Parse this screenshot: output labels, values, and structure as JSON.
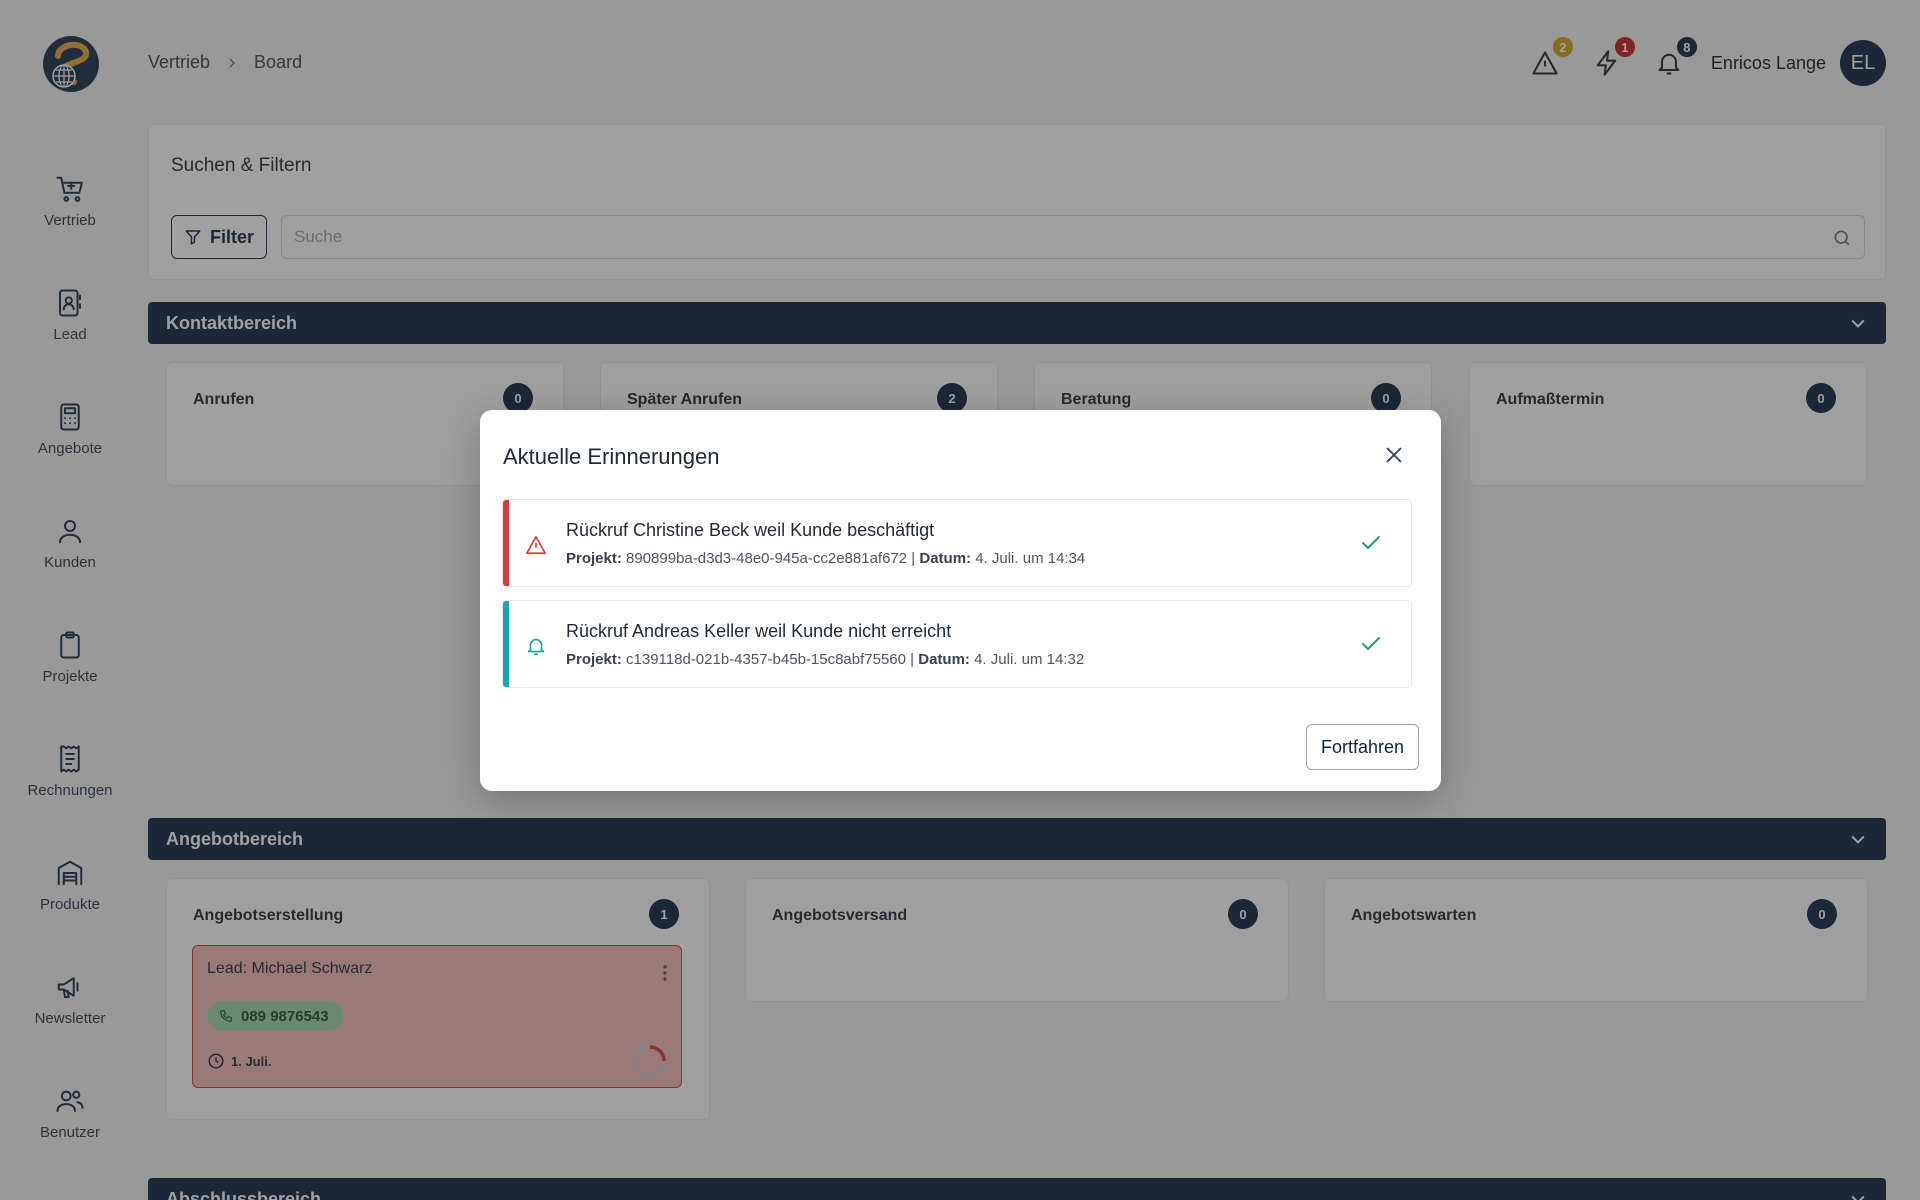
{
  "sidebar": {
    "items": [
      {
        "label": "Vertrieb",
        "icon": "cart-plus-icon"
      },
      {
        "label": "Lead",
        "icon": "contact-book-icon"
      },
      {
        "label": "Angebote",
        "icon": "calculator-icon"
      },
      {
        "label": "Kunden",
        "icon": "user-icon"
      },
      {
        "label": "Projekte",
        "icon": "clipboard-icon"
      },
      {
        "label": "Rechnungen",
        "icon": "receipt-icon"
      },
      {
        "label": "Produkte",
        "icon": "warehouse-icon"
      },
      {
        "label": "Newsletter",
        "icon": "megaphone-icon"
      },
      {
        "label": "Benutzer",
        "icon": "users-icon"
      }
    ]
  },
  "header": {
    "breadcrumb": [
      "Vertrieb",
      "Board"
    ],
    "badges": {
      "warnings": "2",
      "actions": "1",
      "notifications": "8"
    },
    "user_name": "Enricos Lange",
    "avatar_initials": "EL"
  },
  "search": {
    "title": "Suchen & Filtern",
    "filter_label": "Filter",
    "placeholder": "Suche"
  },
  "sections": {
    "contact": {
      "title": "Kontaktbereich",
      "columns": [
        {
          "title": "Anrufen",
          "count": "0"
        },
        {
          "title": "Später Anrufen",
          "count": "2"
        },
        {
          "title": "Beratung",
          "count": "0"
        },
        {
          "title": "Aufmaßtermin",
          "count": "0"
        }
      ]
    },
    "offer": {
      "title": "Angebotbereich",
      "columns": [
        {
          "title": "Angebotserstellung",
          "count": "1"
        },
        {
          "title": "Angebotsversand",
          "count": "0"
        },
        {
          "title": "Angebotswarten",
          "count": "0"
        }
      ]
    },
    "closing": {
      "title": "Abschlussbereich"
    }
  },
  "lead_card": {
    "title": "Lead: Michael Schwarz",
    "phone": "089 9876543",
    "date": "1. Juli."
  },
  "modal": {
    "title": "Aktuelle Erinnerungen",
    "reminders": [
      {
        "title": "Rückruf Christine Beck weil Kunde beschäftigt",
        "project_label": "Projekt:",
        "project_id": "890899ba-d3d3-48e0-945a-cc2e881af672",
        "separator": "|",
        "date_label": "Datum:",
        "date": "4. Juli. um 14:34",
        "type": "warning"
      },
      {
        "title": "Rückruf Andreas Keller weil Kunde nicht erreicht",
        "project_label": "Projekt:",
        "project_id": "c139118d-021b-4357-b45b-15c8abf75560",
        "separator": "|",
        "date_label": "Datum:",
        "date": "4. Juli. um 14:32",
        "type": "notification"
      }
    ],
    "continue_label": "Fortfahren"
  },
  "colors": {
    "primary": "#0f2340",
    "warning_badge": "#d4a017",
    "action_badge": "#c81e1e",
    "reminder_warning": "#d93a3a",
    "reminder_info": "#1aa6b0",
    "check": "#22a06b"
  }
}
